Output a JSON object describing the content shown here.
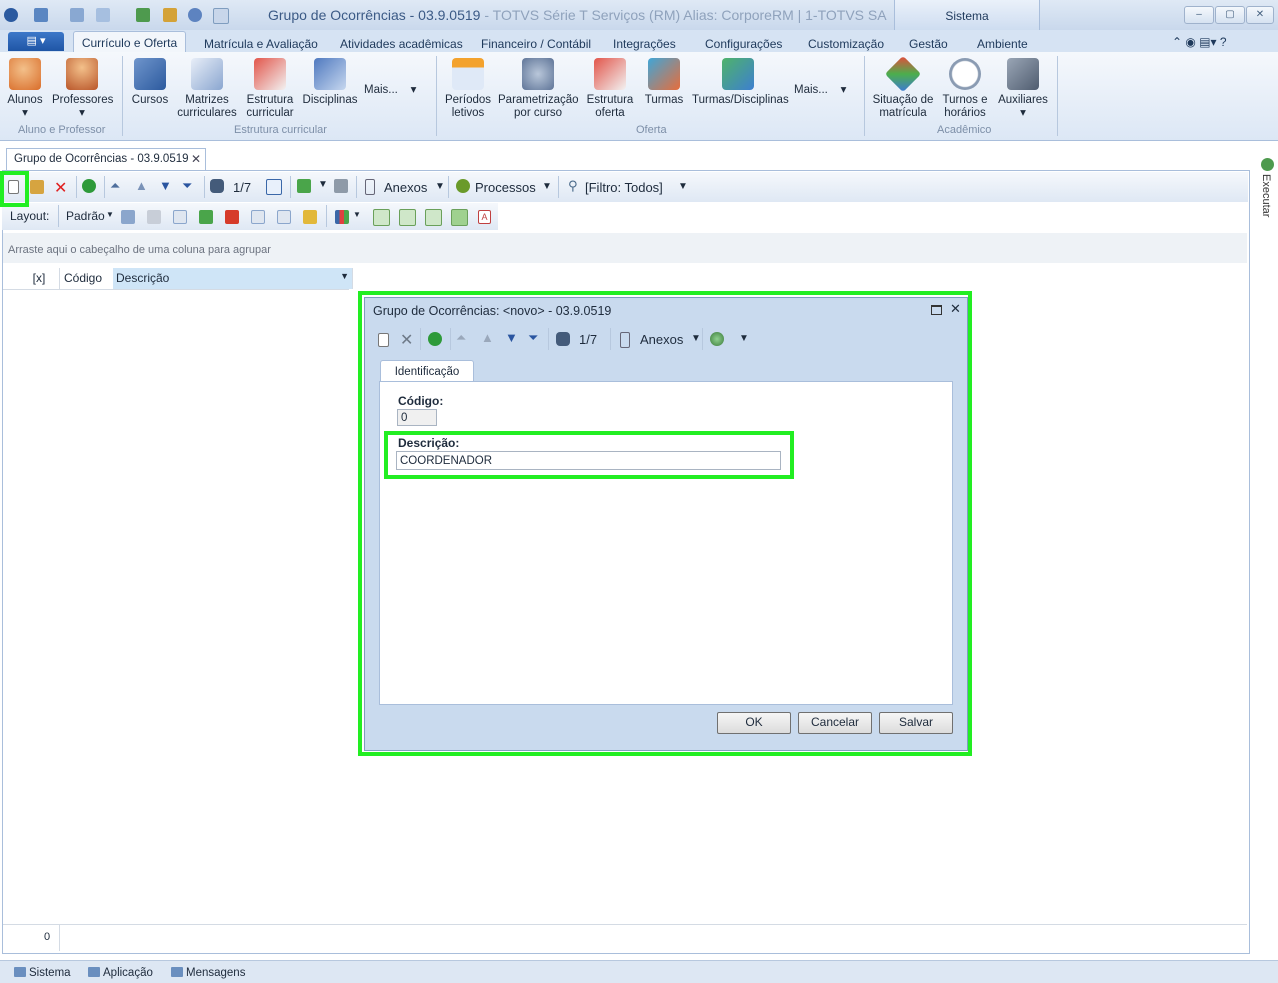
{
  "app": {
    "title_main": "Grupo de Ocorrências - 03.9.0519",
    "title_rest": " - TOTVS Série T Serviços (RM) Alias: CorporeRM | 1-TOTVS SA",
    "context_tab": "Sistema"
  },
  "tabs": [
    "Currículo e Oferta",
    "Matrícula e Avaliação",
    "Atividades acadêmicas",
    "Financeiro / Contábil",
    "Integrações",
    "Configurações",
    "Customização",
    "Gestão",
    "Ambiente"
  ],
  "ribbon": {
    "aluno_professor": {
      "label": "Aluno e Professor",
      "items": [
        "Alunos",
        "Professores"
      ]
    },
    "estrutura": {
      "label": "Estrutura curricular",
      "items": [
        "Cursos",
        "Matrizes curriculares",
        "Estrutura curricular",
        "Disciplinas",
        "Mais..."
      ]
    },
    "oferta": {
      "label": "Oferta",
      "items": [
        "Períodos letivos",
        "Parametrização por curso",
        "Estrutura oferta",
        "Turmas",
        "Turmas/Disciplinas",
        "Mais..."
      ]
    },
    "academico": {
      "label": "Acadêmico",
      "items": [
        "Situação de matrícula",
        "Turnos e horários",
        "Auxiliares"
      ]
    }
  },
  "document_tab": "Grupo de Ocorrências - 03.9.0519",
  "toolbar": {
    "page": "1/7",
    "anexos": "Anexos",
    "processos": "Processos",
    "filtro": "[Filtro: Todos]",
    "layout_label": "Layout:",
    "layout_value": "Padrão"
  },
  "grid": {
    "group_hint": "Arraste aqui o cabeçalho de uma coluna para agrupar",
    "columns": [
      "[x]",
      "Código",
      "Descrição"
    ],
    "count": "0"
  },
  "dialog": {
    "title": "Grupo de Ocorrências: <novo> - 03.9.0519",
    "page": "1/7",
    "anexos": "Anexos",
    "tab": "Identificação",
    "codigo_label": "Código:",
    "codigo_value": "0",
    "descricao_label": "Descrição:",
    "descricao_value": "COORDENADOR",
    "ok": "OK",
    "cancelar": "Cancelar",
    "salvar": "Salvar"
  },
  "side": {
    "executar": "Executar"
  },
  "bottom": [
    "Sistema",
    "Aplicação",
    "Mensagens"
  ],
  "colors": {
    "highlight": "#22ee22",
    "accent": "#1f55a5"
  }
}
